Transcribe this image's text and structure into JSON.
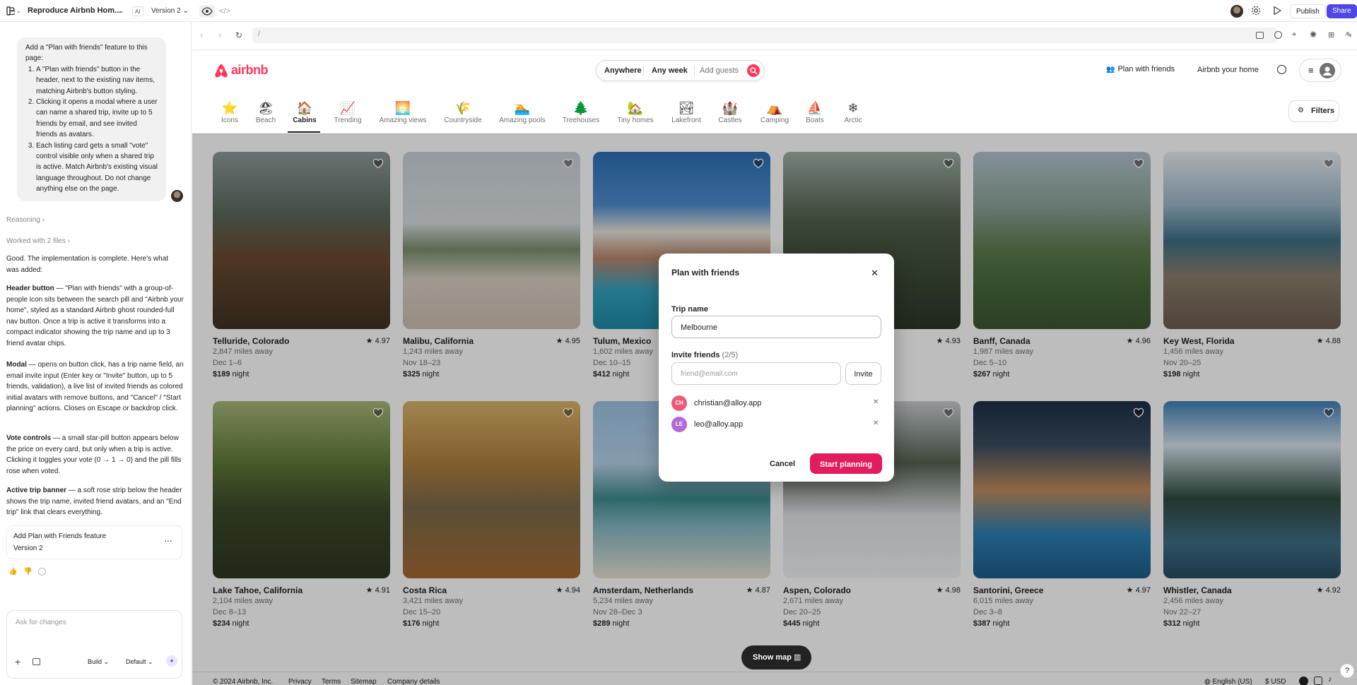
{
  "topbar": {
    "project_title": "Reproduce Airbnb Hom...",
    "ai_badge": "AI",
    "version": "Version 2",
    "publish_label": "Publish",
    "share_label": "Share"
  },
  "chat": {
    "user_message_intro": "Add a \"Plan with friends\" feature to this page:",
    "user_message_items": [
      "A \"Plan with friends\" button in the header, next to the existing nav items, matching Airbnb's button styling.",
      "Clicking it opens a modal where a user can name a shared trip, invite up to 5 friends by email, and see invited friends as avatars.",
      "Each listing card gets a small \"vote\" control visible only when a shared trip is active. Match Airbnb's existing visual language throughout. Do not change anything else on the page."
    ],
    "reasoning_label": "Reasoning",
    "worked_label": "Worked with 2 files",
    "reply_intro": "Good. The implementation is complete. Here's what was added:",
    "reply_sections": [
      {
        "heading": "Header button",
        "text": " — \"Plan with friends\" with a group-of-people icon sits between the search pill and \"Airbnb your home\", styled as a standard Airbnb ghost rounded-full nav button. Once a trip is active it transforms into a compact indicator showing the trip name and up to 3 friend avatar chips."
      },
      {
        "heading": "Modal",
        "text": " — opens on button click, has a trip name field, an email invite input (Enter key or \"Invite\" button, up to 5 friends, validation), a live list of invited friends as colored initial avatars with remove buttons, and \"Cancel\" / \"Start planning\" actions. Closes on Escape or backdrop click."
      },
      {
        "heading": "Vote controls",
        "text": " — a small star-pill button appears below the price on every card, but only when a trip is active. Clicking it toggles your vote (0 → 1 → 0) and the pill fills rose when voted."
      },
      {
        "heading": "Active trip banner",
        "text": " — a soft rose strip below the header shows the trip name, invited friend avatars, and an \"End trip\" link that clears everything."
      }
    ],
    "version_card_title": "Add Plan with Friends feature",
    "version_card_sub": "Version 2",
    "input_placeholder": "Ask for changes",
    "build_label": "Build",
    "default_label": "Default"
  },
  "browser": {
    "url": "/"
  },
  "airbnb": {
    "logo_text": "airbnb",
    "search": {
      "where": "Anywhere",
      "when": "Any week",
      "who": "Add guests"
    },
    "plan_friends_label": "Plan with friends",
    "host_label": "Airbnb your home",
    "filters_label": "Filters",
    "brand_color": "#ff385c",
    "categories": [
      {
        "label": "Icons",
        "icon": "star-icon",
        "glyph": "⭐"
      },
      {
        "label": "Beach",
        "icon": "beach-umbrella-icon",
        "glyph": "🏖"
      },
      {
        "label": "Cabins",
        "icon": "cabin-icon",
        "glyph": "🏠"
      },
      {
        "label": "Trending",
        "icon": "trending-chart-icon",
        "glyph": "📈"
      },
      {
        "label": "Amazing views",
        "icon": "sunset-view-icon",
        "glyph": "🌅"
      },
      {
        "label": "Countryside",
        "icon": "wheat-icon",
        "glyph": "🌾"
      },
      {
        "label": "Amazing pools",
        "icon": "pool-icon",
        "glyph": "🏊"
      },
      {
        "label": "Treehouses",
        "icon": "tree-icon",
        "glyph": "🌲"
      },
      {
        "label": "Tiny homes",
        "icon": "tiny-home-icon",
        "glyph": "🏡"
      },
      {
        "label": "Lakefront",
        "icon": "lake-icon",
        "glyph": "🏞"
      },
      {
        "label": "Castles",
        "icon": "castle-icon",
        "glyph": "🏰"
      },
      {
        "label": "Camping",
        "icon": "tent-icon",
        "glyph": "⛺"
      },
      {
        "label": "Boats",
        "icon": "boat-icon",
        "glyph": "⛵"
      },
      {
        "label": "Arctic",
        "icon": "snowflake-icon",
        "glyph": "❄"
      }
    ],
    "listings": [
      {
        "title": "Telluride, Colorado",
        "rating": "4.97",
        "distance": "2,847 miles away",
        "dates": "Dec 1–6",
        "price": "$189",
        "unit": "night",
        "img": "cabin-forest"
      },
      {
        "title": "Malibu, California",
        "rating": "4.95",
        "distance": "1,243 miles away",
        "dates": "Nov 18–23",
        "price": "$325",
        "unit": "night",
        "img": "beach-house"
      },
      {
        "title": "Tulum, Mexico",
        "rating": "",
        "distance": "1,602 miles away",
        "dates": "Dec 10–15",
        "price": "$412",
        "unit": "night",
        "img": "modern-pool"
      },
      {
        "title": "",
        "rating": "4.93",
        "distance": "",
        "dates": "",
        "price": "",
        "unit": "",
        "img": "treehouse"
      },
      {
        "title": "Banff, Canada",
        "rating": "4.96",
        "distance": "1,987 miles away",
        "dates": "Dec 5–10",
        "price": "$267",
        "unit": "night",
        "img": "mountain-cabin"
      },
      {
        "title": "Key West, Florida",
        "rating": "4.88",
        "distance": "1,456 miles away",
        "dates": "Nov 20–25",
        "price": "$198",
        "unit": "night",
        "img": "porch-ocean"
      },
      {
        "title": "Lake Tahoe, California",
        "rating": "4.91",
        "distance": "2,104 miles away",
        "dates": "Dec 8–13",
        "price": "$234",
        "unit": "night",
        "img": "forest-house"
      },
      {
        "title": "Costa Rica",
        "rating": "4.94",
        "distance": "3,421 miles away",
        "dates": "Dec 15–20",
        "price": "$176",
        "unit": "night",
        "img": "autumn-treehouse"
      },
      {
        "title": "Amsterdam, Netherlands",
        "rating": "4.87",
        "distance": "5,234 miles away",
        "dates": "Nov 28–Dec 3",
        "price": "$289",
        "unit": "night",
        "img": "beach-cottages"
      },
      {
        "title": "Aspen, Colorado",
        "rating": "4.98",
        "distance": "2,671 miles away",
        "dates": "Dec 20–25",
        "price": "$445",
        "unit": "night",
        "img": "snow-cabin"
      },
      {
        "title": "Santorini, Greece",
        "rating": "4.97",
        "distance": "6,015 miles away",
        "dates": "Dec 3–8",
        "price": "$387",
        "unit": "night",
        "img": "villa-pool"
      },
      {
        "title": "Whistler, Canada",
        "rating": "4.92",
        "distance": "2,456 miles away",
        "dates": "Nov 22–27",
        "price": "$312",
        "unit": "night",
        "img": "lake-cabin"
      }
    ],
    "show_map_label": "Show map",
    "footer": {
      "copyright": "© 2024 Airbnb, Inc.",
      "links": [
        "Privacy",
        "Terms",
        "Sitemap",
        "Company details"
      ],
      "language": "English (US)",
      "currency": "$ USD"
    }
  },
  "modal": {
    "title": "Plan with friends",
    "trip_label": "Trip name",
    "trip_value": "Melbourne",
    "invite_label": "Invite friends",
    "invite_count": "(2/5)",
    "email_placeholder": "friend@email.com",
    "invite_button": "Invite",
    "friends": [
      {
        "initials": "CH",
        "email": "christian@alloy.app",
        "color": "#f0587a"
      },
      {
        "initials": "LE",
        "email": "leo@alloy.app",
        "color": "#b36ad9"
      }
    ],
    "cancel_label": "Cancel",
    "start_label": "Start planning"
  }
}
